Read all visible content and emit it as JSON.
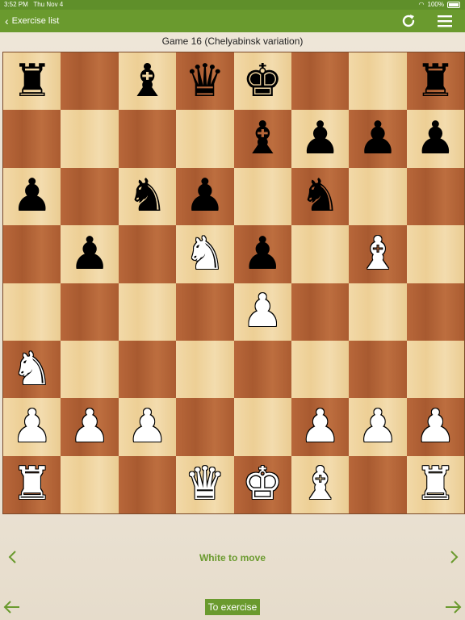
{
  "status_bar": {
    "time": "3:52 PM",
    "date": "Thu Nov 4",
    "battery": "100%"
  },
  "nav": {
    "back_label": "Exercise list"
  },
  "game_title": "Game 16 (Chelyabinsk variation)",
  "turn_text": "White to move",
  "to_exercise_label": "To exercise",
  "colors": {
    "accent": "#6a9a2e",
    "light_square": "#efd39f",
    "dark_square": "#b2613a"
  },
  "board": [
    [
      "bR",
      "",
      "bB",
      "bQ",
      "bK",
      "",
      "",
      "bR"
    ],
    [
      "",
      "",
      "",
      "",
      "bB",
      "bP",
      "bP",
      "bP"
    ],
    [
      "bP",
      "",
      "bN",
      "bP",
      "",
      "bN",
      "",
      ""
    ],
    [
      "",
      "bP",
      "",
      "wN",
      "bP",
      "",
      "wB",
      ""
    ],
    [
      "",
      "",
      "",
      "",
      "wP",
      "",
      "",
      ""
    ],
    [
      "wN",
      "",
      "",
      "",
      "",
      "",
      "",
      ""
    ],
    [
      "wP",
      "wP",
      "wP",
      "",
      "",
      "wP",
      "wP",
      "wP"
    ],
    [
      "wR",
      "",
      "",
      "wQ",
      "wK",
      "wB",
      "",
      "wR"
    ]
  ]
}
